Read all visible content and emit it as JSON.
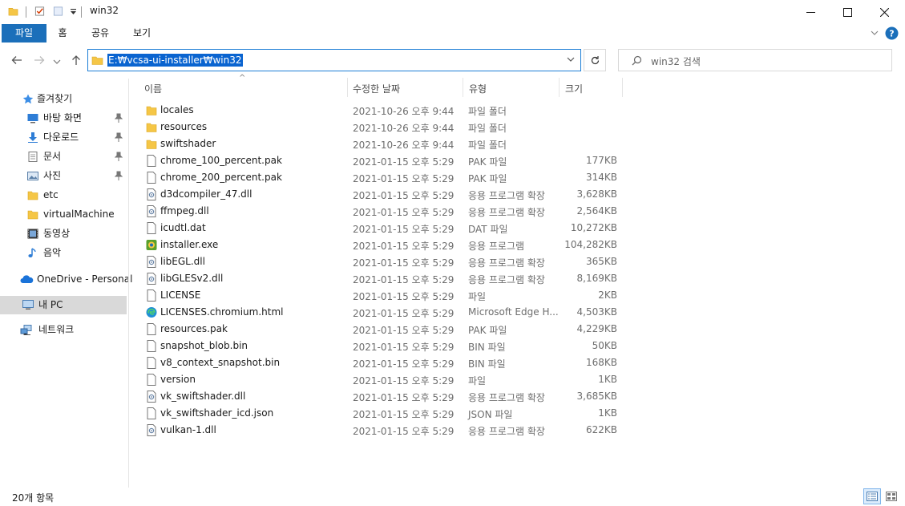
{
  "window": {
    "title": "win32"
  },
  "ribbon": {
    "tabs": [
      "파일",
      "홈",
      "공유",
      "보기"
    ]
  },
  "address": {
    "path": "E:₩vcsa-ui-installer₩win32"
  },
  "search": {
    "placeholder": "win32 검색"
  },
  "sidebar": {
    "quick_access": "즐겨찾기",
    "items": [
      {
        "label": "바탕 화면",
        "icon": "desktop-icon",
        "pinned": true
      },
      {
        "label": "다운로드",
        "icon": "download-icon",
        "pinned": true
      },
      {
        "label": "문서",
        "icon": "document-icon",
        "pinned": true
      },
      {
        "label": "사진",
        "icon": "pictures-icon",
        "pinned": true
      },
      {
        "label": "etc",
        "icon": "folder-icon",
        "pinned": false
      },
      {
        "label": "virtualMachine",
        "icon": "folder-icon",
        "pinned": false
      },
      {
        "label": "동영상",
        "icon": "video-icon",
        "pinned": false
      },
      {
        "label": "음악",
        "icon": "music-icon",
        "pinned": false
      }
    ],
    "onedrive": "OneDrive - Personal",
    "this_pc": "내 PC",
    "network": "네트워크"
  },
  "columns": {
    "name": "이름",
    "date": "수정한 날짜",
    "type": "유형",
    "size": "크기"
  },
  "files": [
    {
      "name": "locales",
      "date": "2021-10-26 오후 9:44",
      "type": "파일 폴더",
      "size": "",
      "icon": "folder-icon"
    },
    {
      "name": "resources",
      "date": "2021-10-26 오후 9:44",
      "type": "파일 폴더",
      "size": "",
      "icon": "folder-icon"
    },
    {
      "name": "swiftshader",
      "date": "2021-10-26 오후 9:44",
      "type": "파일 폴더",
      "size": "",
      "icon": "folder-icon"
    },
    {
      "name": "chrome_100_percent.pak",
      "date": "2021-01-15 오후 5:29",
      "type": "PAK 파일",
      "size": "177KB",
      "icon": "file-icon"
    },
    {
      "name": "chrome_200_percent.pak",
      "date": "2021-01-15 오후 5:29",
      "type": "PAK 파일",
      "size": "314KB",
      "icon": "file-icon"
    },
    {
      "name": "d3dcompiler_47.dll",
      "date": "2021-01-15 오후 5:29",
      "type": "응용 프로그램 확장",
      "size": "3,628KB",
      "icon": "dll-icon"
    },
    {
      "name": "ffmpeg.dll",
      "date": "2021-01-15 오후 5:29",
      "type": "응용 프로그램 확장",
      "size": "2,564KB",
      "icon": "dll-icon"
    },
    {
      "name": "icudtl.dat",
      "date": "2021-01-15 오후 5:29",
      "type": "DAT 파일",
      "size": "10,272KB",
      "icon": "file-icon"
    },
    {
      "name": "installer.exe",
      "date": "2021-01-15 오후 5:29",
      "type": "응용 프로그램",
      "size": "104,282KB",
      "icon": "exe-icon"
    },
    {
      "name": "libEGL.dll",
      "date": "2021-01-15 오후 5:29",
      "type": "응용 프로그램 확장",
      "size": "365KB",
      "icon": "dll-icon"
    },
    {
      "name": "libGLESv2.dll",
      "date": "2021-01-15 오후 5:29",
      "type": "응용 프로그램 확장",
      "size": "8,169KB",
      "icon": "dll-icon"
    },
    {
      "name": "LICENSE",
      "date": "2021-01-15 오후 5:29",
      "type": "파일",
      "size": "2KB",
      "icon": "file-icon"
    },
    {
      "name": "LICENSES.chromium.html",
      "date": "2021-01-15 오후 5:29",
      "type": "Microsoft Edge H...",
      "size": "4,503KB",
      "icon": "edge-icon"
    },
    {
      "name": "resources.pak",
      "date": "2021-01-15 오후 5:29",
      "type": "PAK 파일",
      "size": "4,229KB",
      "icon": "file-icon"
    },
    {
      "name": "snapshot_blob.bin",
      "date": "2021-01-15 오후 5:29",
      "type": "BIN 파일",
      "size": "50KB",
      "icon": "file-icon"
    },
    {
      "name": "v8_context_snapshot.bin",
      "date": "2021-01-15 오후 5:29",
      "type": "BIN 파일",
      "size": "168KB",
      "icon": "file-icon"
    },
    {
      "name": "version",
      "date": "2021-01-15 오후 5:29",
      "type": "파일",
      "size": "1KB",
      "icon": "file-icon"
    },
    {
      "name": "vk_swiftshader.dll",
      "date": "2021-01-15 오후 5:29",
      "type": "응용 프로그램 확장",
      "size": "3,685KB",
      "icon": "dll-icon"
    },
    {
      "name": "vk_swiftshader_icd.json",
      "date": "2021-01-15 오후 5:29",
      "type": "JSON 파일",
      "size": "1KB",
      "icon": "file-icon"
    },
    {
      "name": "vulkan-1.dll",
      "date": "2021-01-15 오후 5:29",
      "type": "응용 프로그램 확장",
      "size": "622KB",
      "icon": "dll-icon"
    }
  ],
  "status": {
    "item_count": "20개 항목"
  },
  "colors": {
    "accent": "#1b6fba",
    "folder": "#f5c646",
    "selection": "#0a64d0"
  }
}
